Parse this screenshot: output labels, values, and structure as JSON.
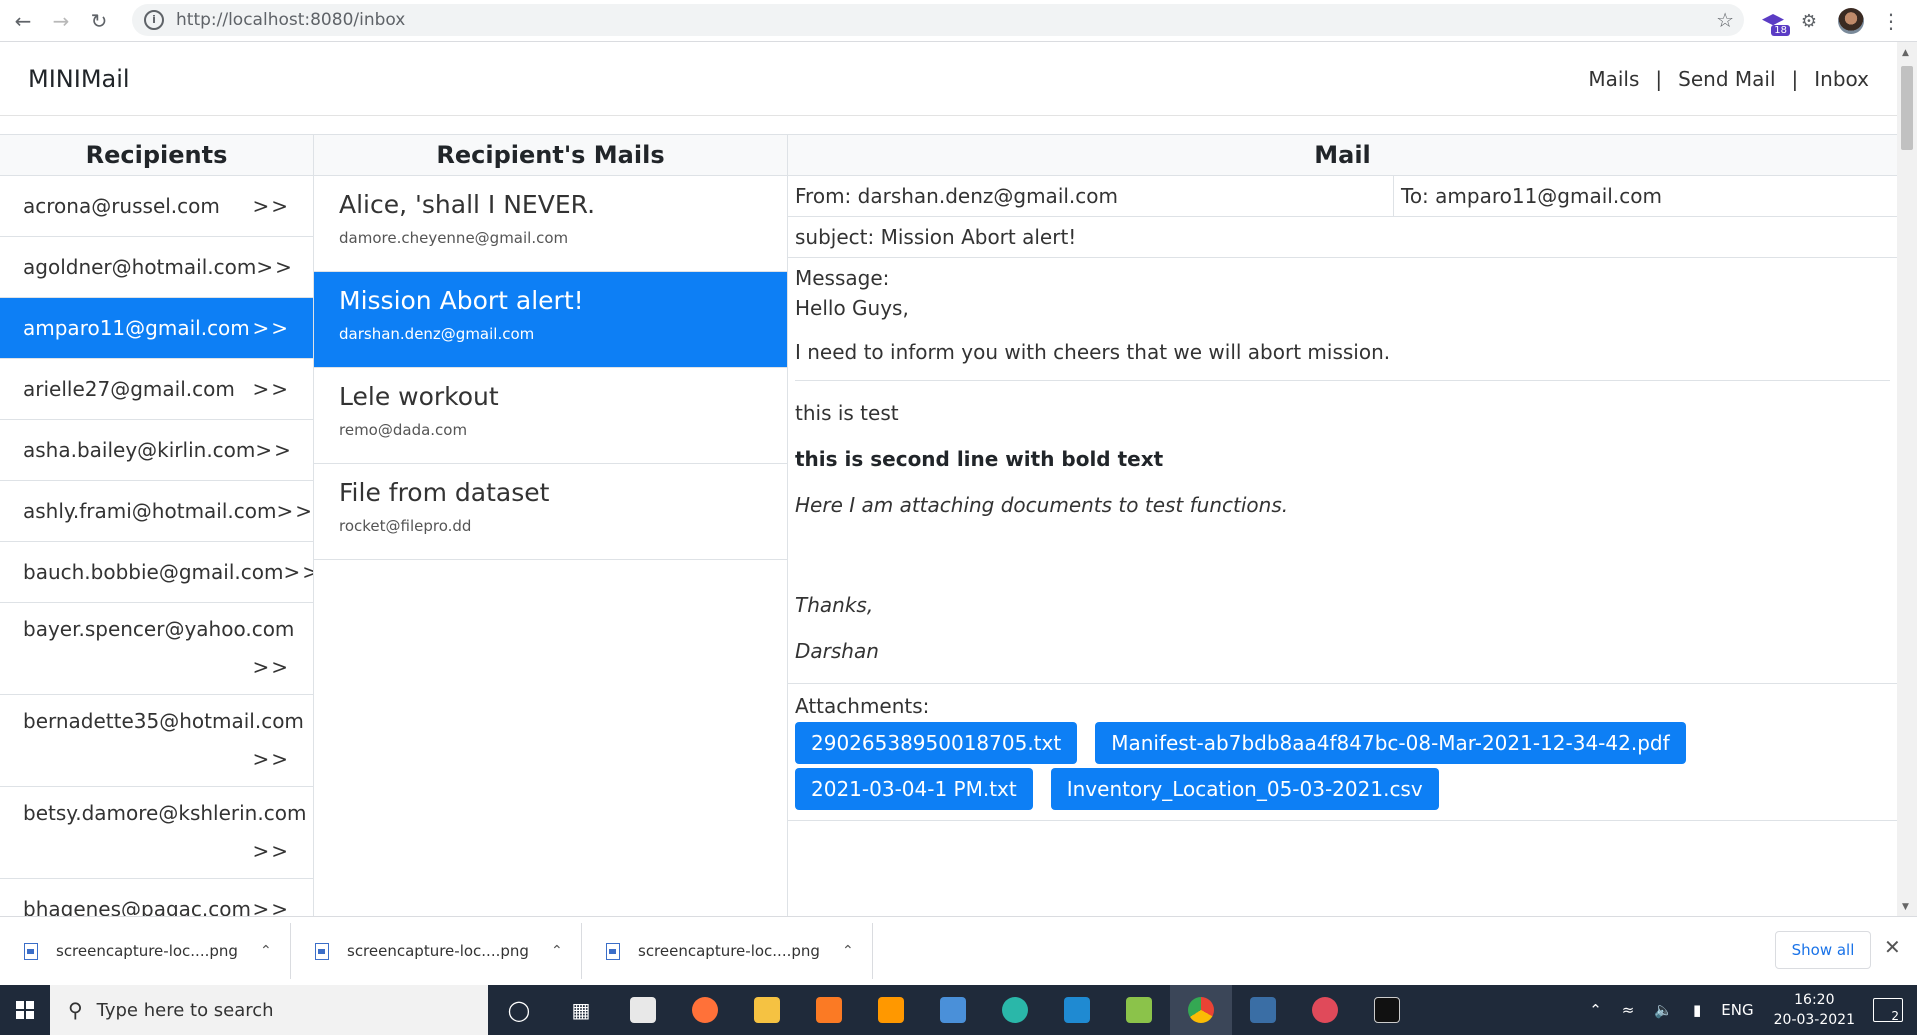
{
  "browser": {
    "url": "http://localhost:8080/inbox",
    "badge_count": "18"
  },
  "navbar": {
    "brand": "MINIMail",
    "links": [
      "Mails",
      "Send Mail",
      "Inbox"
    ],
    "separator": "|"
  },
  "columns": {
    "recipients_title": "Recipients",
    "mails_title": "Recipient's Mails",
    "mail_title": "Mail"
  },
  "recipients": [
    {
      "email": "acrona@russel.com",
      "arrow": ">>",
      "active": false
    },
    {
      "email": "agoldner@hotmail.com",
      "arrow": ">>",
      "active": false
    },
    {
      "email": "amparo11@gmail.com",
      "arrow": ">>",
      "active": true
    },
    {
      "email": "arielle27@gmail.com",
      "arrow": ">>",
      "active": false
    },
    {
      "email": "asha.bailey@kirlin.com",
      "arrow": ">>",
      "active": false
    },
    {
      "email": "ashly.frami@hotmail.com",
      "arrow": ">>",
      "active": false
    },
    {
      "email": "bauch.bobbie@gmail.com",
      "arrow": ">>",
      "active": false
    },
    {
      "email": "bayer.spencer@yahoo.com",
      "arrow": ">>",
      "active": false
    },
    {
      "email": "bernadette35@hotmail.com",
      "arrow": ">>",
      "active": false
    },
    {
      "email": "betsy.damore@kshlerin.com",
      "arrow": ">>",
      "active": false
    },
    {
      "email": "bhagenes@pagac.com",
      "arrow": ">>",
      "active": false
    }
  ],
  "mails": [
    {
      "subject": "Alice, 'shall I NEVER.",
      "from": "damore.cheyenne@gmail.com",
      "active": false
    },
    {
      "subject": "Mission Abort alert!",
      "from": "darshan.denz@gmail.com",
      "active": true
    },
    {
      "subject": "Lele workout",
      "from": "remo@dada.com",
      "active": false
    },
    {
      "subject": "File from dataset",
      "from": "rocket@filepro.dd",
      "active": false
    }
  ],
  "mail": {
    "from": "From: darshan.denz@gmail.com",
    "to": "To: amparo11@gmail.com",
    "subject": "subject: Mission Abort alert!",
    "message_label": "Message:",
    "greeting": "Hello Guys,",
    "body1": "I need to inform you with cheers that we will abort mission.",
    "line_test": "this is test",
    "line_bold": "this is second line with bold text",
    "line_italic": "Here I am attaching documents to test functions.",
    "thanks": "Thanks,",
    "signature": "Darshan",
    "attachments_label": "Attachments:",
    "attachments": [
      "29026538950018705.txt",
      "Manifest-ab7bdb8aa4f847bc-08-Mar-2021-12-34-42.pdf",
      "2021-03-04-1 PM.txt",
      "Inventory_Location_05-03-2021.csv"
    ]
  },
  "downloads": {
    "items": [
      "screencapture-loc....png",
      "screencapture-loc....png",
      "screencapture-loc....png"
    ],
    "show_all": "Show all"
  },
  "taskbar": {
    "search_placeholder": "Type here to search",
    "lang": "ENG",
    "time": "16:20",
    "date": "20-03-2021",
    "notifications": "2"
  }
}
